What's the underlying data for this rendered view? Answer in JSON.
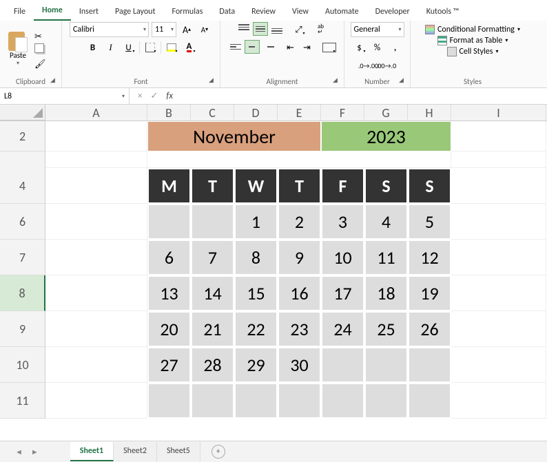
{
  "menu": {
    "items": [
      "File",
      "Home",
      "Insert",
      "Page Layout",
      "Formulas",
      "Data",
      "Review",
      "View",
      "Automate",
      "Developer",
      "Kutools ™"
    ],
    "active": "Home"
  },
  "ribbon": {
    "clipboard": {
      "paste": "Paste",
      "label": "Clipboard"
    },
    "font": {
      "name": "Calibri",
      "size": "11",
      "label": "Font"
    },
    "alignment": {
      "label": "Alignment"
    },
    "number": {
      "format": "General",
      "label": "Number"
    },
    "styles": {
      "cf": "Conditional Formatting",
      "fat": "Format as Table",
      "cs": "Cell Styles",
      "label": "Styles"
    }
  },
  "namebox": "L8",
  "columns": [
    "A",
    "B",
    "C",
    "D",
    "E",
    "F",
    "G",
    "H",
    "I"
  ],
  "row_numbers": [
    "2",
    "4",
    "6",
    "7",
    "8",
    "9",
    "10",
    "11"
  ],
  "calendar": {
    "month": "November",
    "year": "2023",
    "days": [
      "M",
      "T",
      "W",
      "T",
      "F",
      "S",
      "S"
    ],
    "grid": [
      [
        "",
        "",
        "1",
        "2",
        "3",
        "4",
        "5"
      ],
      [
        "6",
        "7",
        "8",
        "9",
        "10",
        "11",
        "12"
      ],
      [
        "13",
        "14",
        "15",
        "16",
        "17",
        "18",
        "19"
      ],
      [
        "20",
        "21",
        "22",
        "23",
        "24",
        "25",
        "26"
      ],
      [
        "27",
        "28",
        "29",
        "30",
        "",
        "",
        ""
      ],
      [
        "",
        "",
        "",
        "",
        "",
        "",
        ""
      ]
    ]
  },
  "sheets": {
    "tabs": [
      "Sheet1",
      "Sheet2",
      "Sheet5"
    ],
    "active": "Sheet1"
  },
  "chart_data": {
    "type": "table",
    "title": "November 2023",
    "columns": [
      "M",
      "T",
      "W",
      "T",
      "F",
      "S",
      "S"
    ],
    "rows": [
      [
        "",
        "",
        "1",
        "2",
        "3",
        "4",
        "5"
      ],
      [
        "6",
        "7",
        "8",
        "9",
        "10",
        "11",
        "12"
      ],
      [
        "13",
        "14",
        "15",
        "16",
        "17",
        "18",
        "19"
      ],
      [
        "20",
        "21",
        "22",
        "23",
        "24",
        "25",
        "26"
      ],
      [
        "27",
        "28",
        "29",
        "30",
        "",
        "",
        ""
      ]
    ]
  }
}
